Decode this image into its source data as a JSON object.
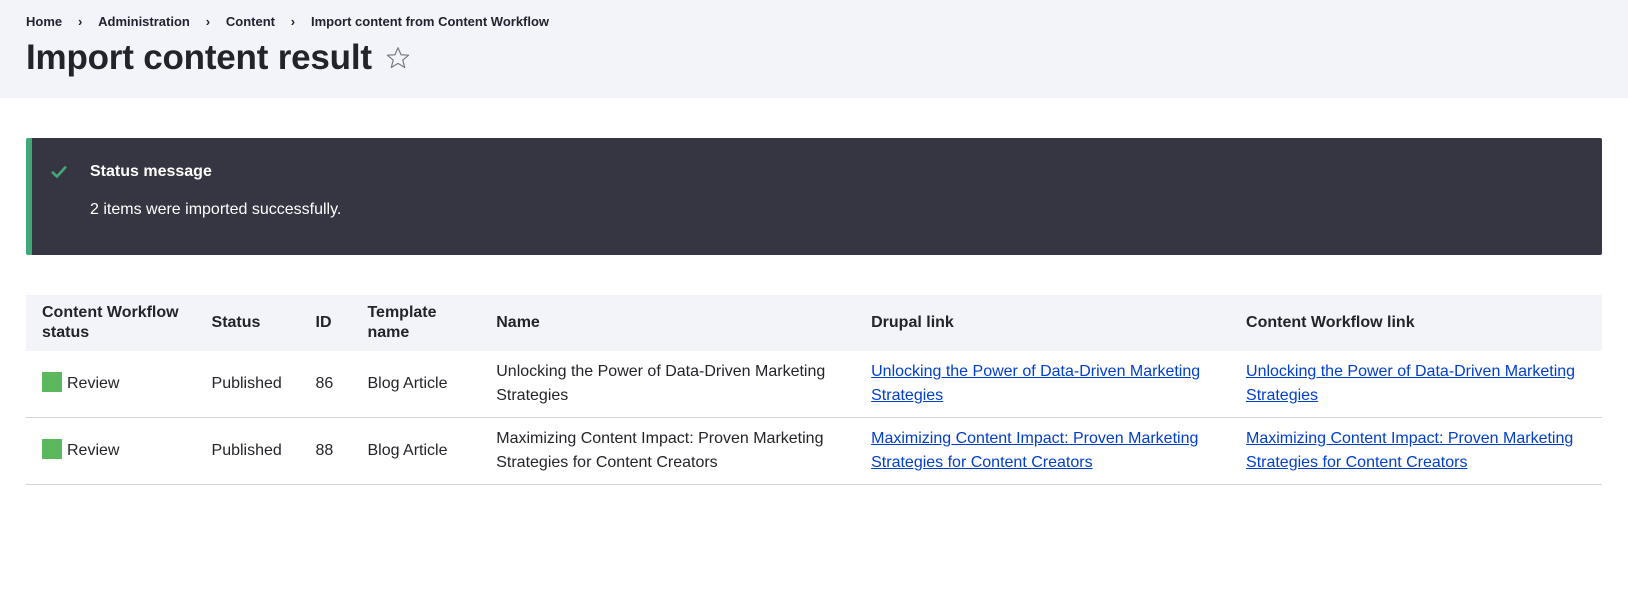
{
  "breadcrumb": {
    "items": [
      "Home",
      "Administration",
      "Content",
      "Import content from Content Workflow"
    ],
    "separator": "›"
  },
  "header": {
    "title": "Import content result",
    "star_icon": "star-outline-icon"
  },
  "status_message": {
    "title": "Status message",
    "body": "2 items were imported successfully.",
    "icon": "check-icon",
    "accent_color": "#42a877"
  },
  "table": {
    "columns": [
      "Content Workflow status",
      "Status",
      "ID",
      "Template name",
      "Name",
      "Drupal link",
      "Content Workflow link"
    ],
    "rows": [
      {
        "workflow_status": "Review",
        "workflow_color": "#5cb85c",
        "status": "Published",
        "id": "86",
        "template": "Blog Article",
        "name": "Unlocking the Power of Data-Driven Marketing Strategies",
        "drupal_link": "Unlocking the Power of Data-Driven Marketing Strategies",
        "workflow_link": "Unlocking the Power of Data-Driven Marketing Strategies"
      },
      {
        "workflow_status": "Review",
        "workflow_color": "#5cb85c",
        "status": "Published",
        "id": "88",
        "template": "Blog Article",
        "name": "Maximizing Content Impact: Proven Marketing Strategies for Content Creators",
        "drupal_link": "Maximizing Content Impact: Proven Marketing Strategies for Content Creators",
        "workflow_link": "Maximizing Content Impact: Proven Marketing Strategies for Content Creators"
      }
    ]
  }
}
